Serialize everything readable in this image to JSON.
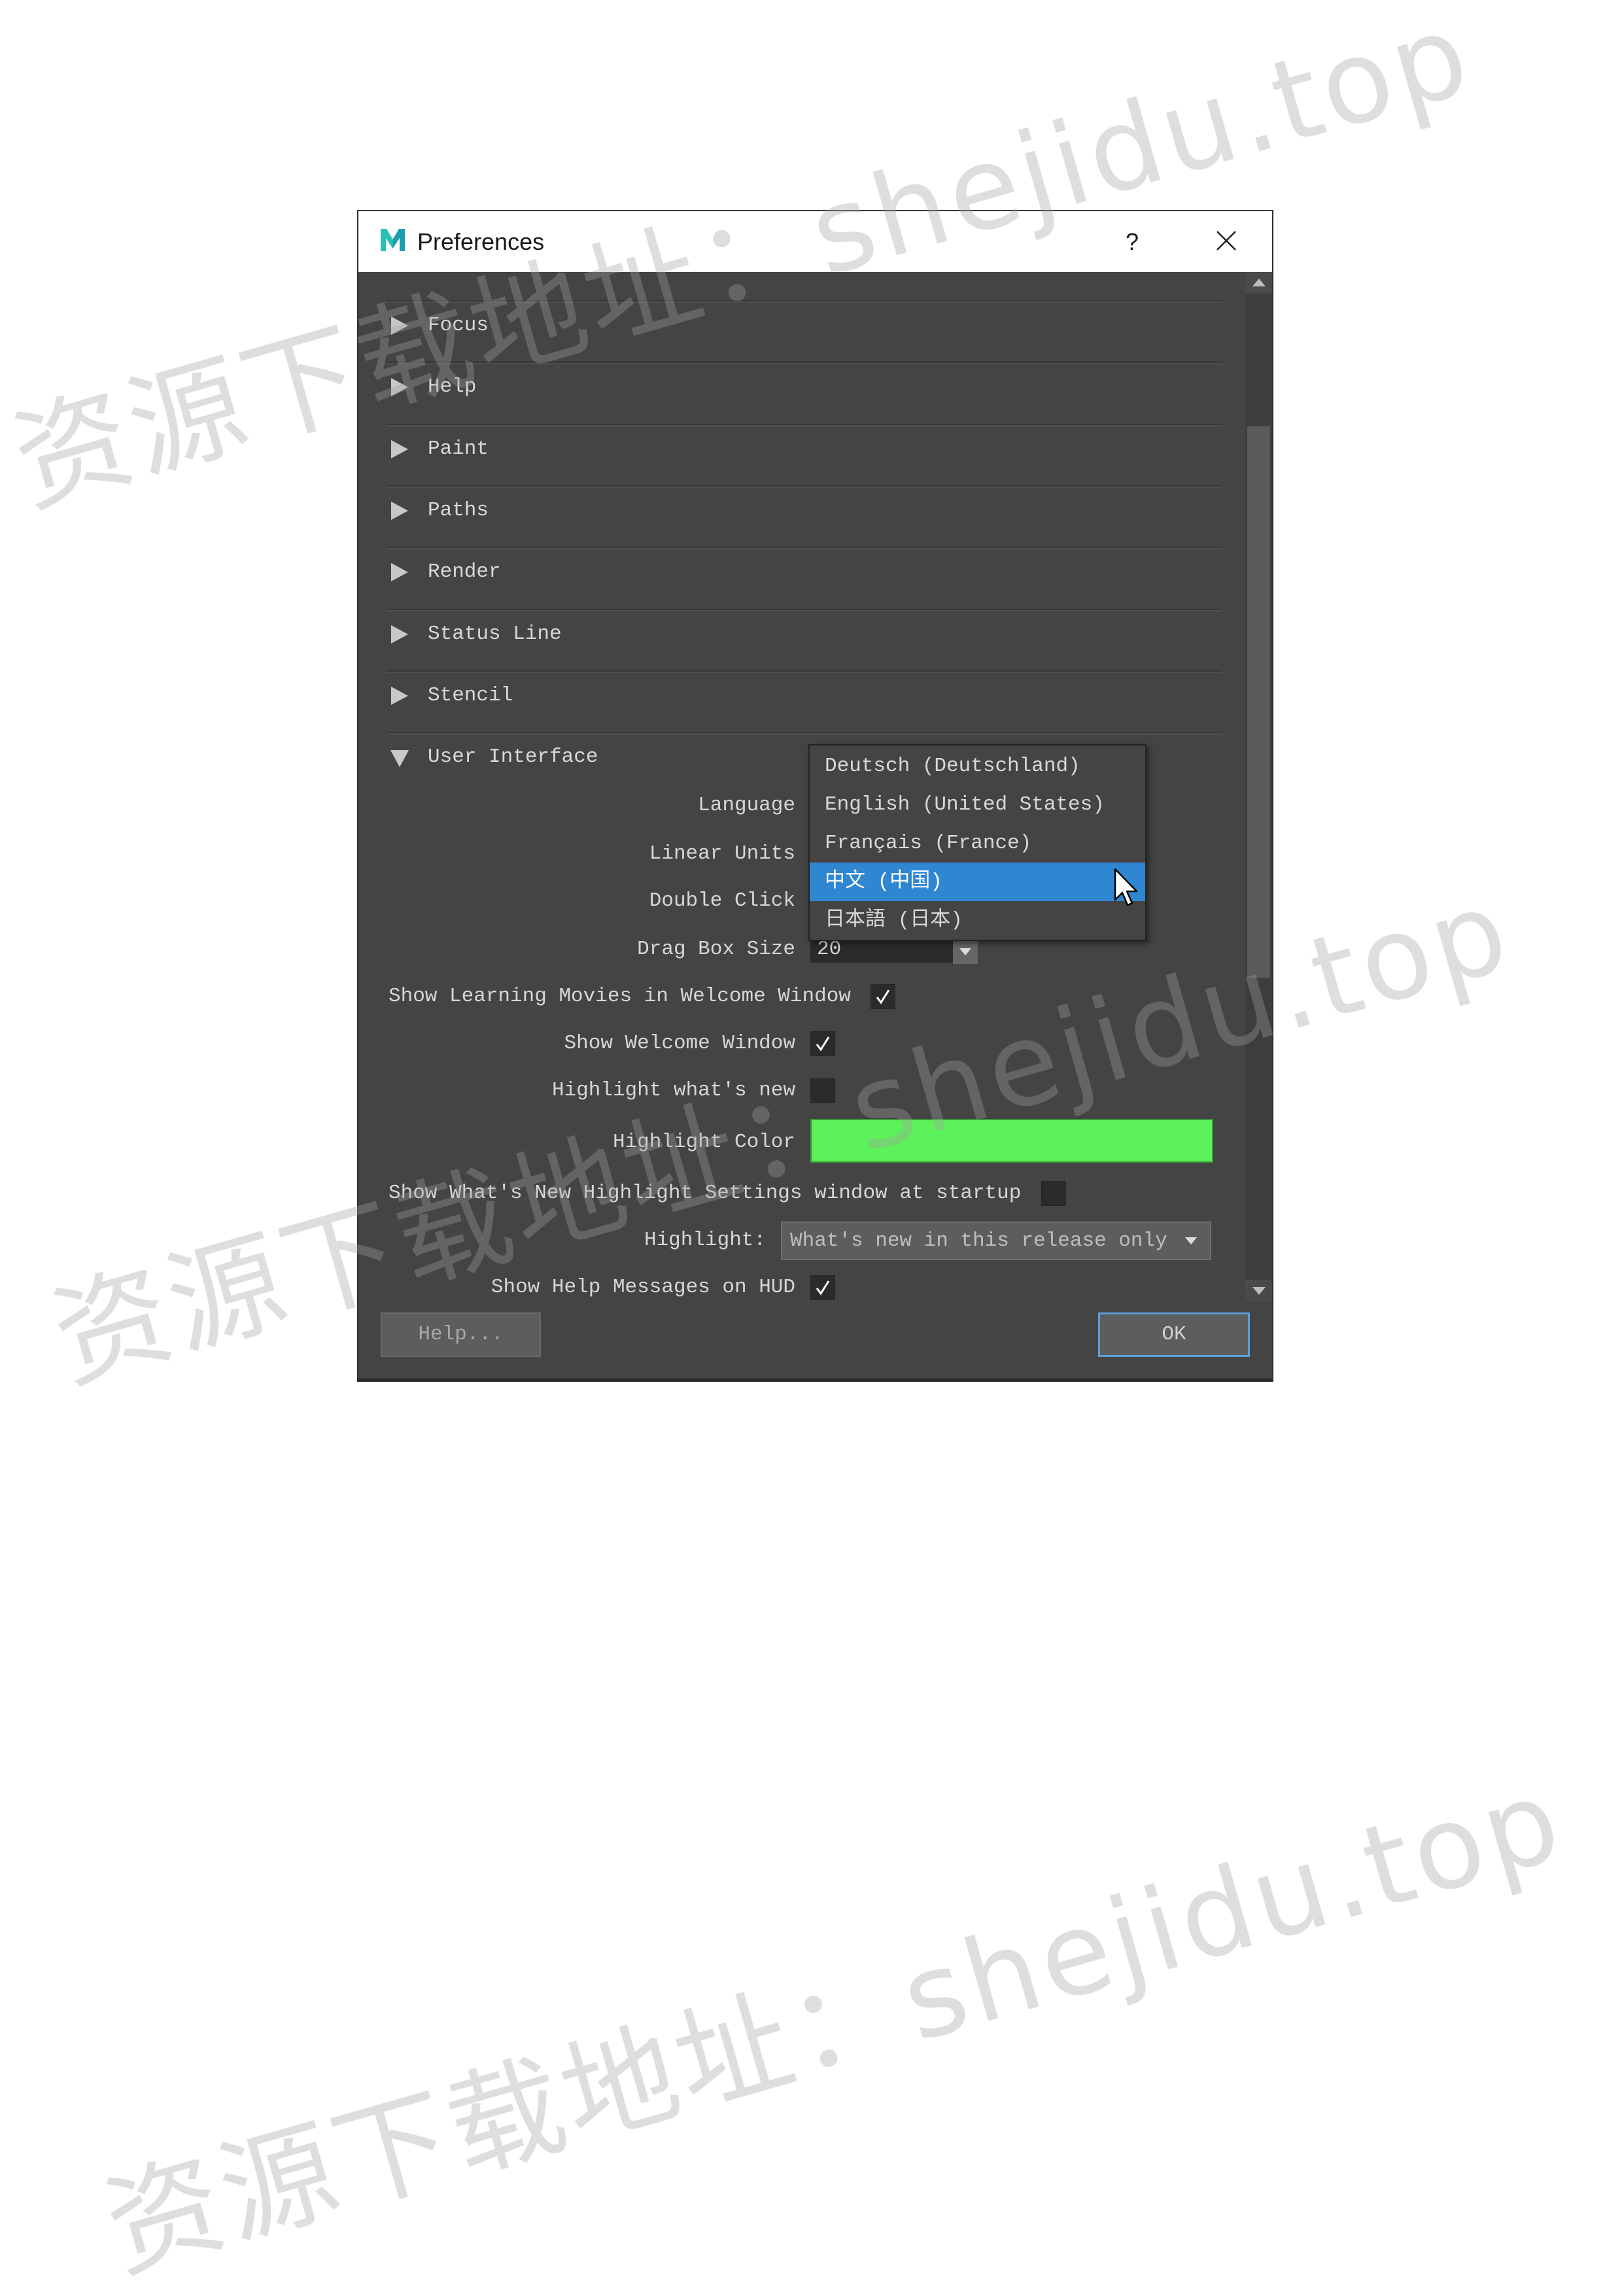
{
  "watermark": {
    "text": "资源下载地址：shejidu.top"
  },
  "dialog": {
    "title": "Preferences",
    "help_label": "?",
    "icons": {
      "app": "maya-icon",
      "close": "close-icon",
      "collapsed": "triangle-right-icon",
      "expanded": "triangle-down-icon",
      "dropdown": "chevron-down-icon",
      "check": "checkmark-icon",
      "cursor": "mouse-pointer-icon"
    },
    "sections": [
      {
        "label": "Focus",
        "expanded": false
      },
      {
        "label": "Help",
        "expanded": false
      },
      {
        "label": "Paint",
        "expanded": false
      },
      {
        "label": "Paths",
        "expanded": false
      },
      {
        "label": "Render",
        "expanded": false
      },
      {
        "label": "Status Line",
        "expanded": false
      },
      {
        "label": "Stencil",
        "expanded": false
      }
    ],
    "user_interface": {
      "label": "User Interface",
      "expanded": true,
      "language": {
        "label": "Language"
      },
      "linear_units": {
        "label": "Linear Units"
      },
      "double_click": {
        "label": "Double Click"
      },
      "drag_box_size": {
        "label": "Drag Box Size",
        "value": "20"
      },
      "show_learning_movies": {
        "label": "Show Learning Movies in Welcome Window",
        "checked": true
      },
      "show_welcome_window": {
        "label": "Show Welcome Window",
        "checked": true
      },
      "highlight_whats_new": {
        "label": "Highlight what's new",
        "checked": false
      },
      "highlight_color": {
        "label": "Highlight Color",
        "value": "#5cf25a"
      },
      "show_whats_new_settings": {
        "label": "Show What's New Highlight Settings window at startup",
        "checked": false
      },
      "highlight": {
        "label": "Highlight:",
        "value": "What's new in this release only"
      },
      "show_help_messages": {
        "label": "Show Help Messages on HUD",
        "checked": true
      }
    },
    "language_dropdown": {
      "options": [
        "Deutsch (Deutschland)",
        "English (United States)",
        "Français (France)",
        "中文 (中国)",
        "日本語 (日本)"
      ],
      "highlighted_index": 3
    },
    "buttons": {
      "help": "Help...",
      "ok": "OK"
    }
  },
  "colors": {
    "panel_background": "#444444",
    "selection": "#2f86d1",
    "ok_focus_border": "#5c9fd8",
    "watermark": "rgba(160,160,160,0.35)"
  }
}
